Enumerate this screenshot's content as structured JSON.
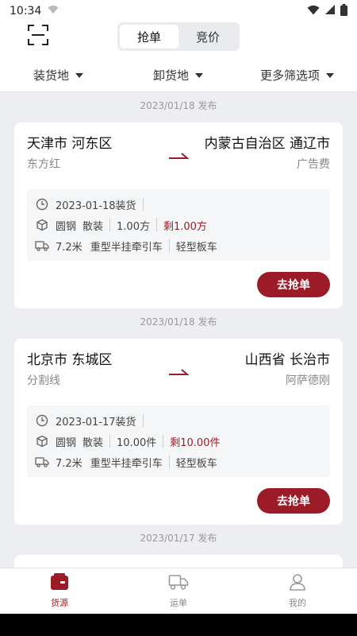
{
  "status": {
    "time": "10:34"
  },
  "header": {
    "tabs": [
      {
        "label": "抢单",
        "active": true
      },
      {
        "label": "竞价",
        "active": false
      }
    ]
  },
  "filters": [
    {
      "label": "装货地"
    },
    {
      "label": "卸货地"
    },
    {
      "label": "更多筛选项"
    }
  ],
  "listings": [
    {
      "publish": "2023/01/18 发布",
      "from_city": "天津市 河东区",
      "from_sub": "东方红",
      "to_city": "内蒙古自治区 通辽市",
      "to_sub": "广告费",
      "load_date": "2023-01-18装货",
      "cargo": "圆钢",
      "packing": "散装",
      "amount": "1.00方",
      "remaining": "剩1.00方",
      "length": "7.2米",
      "truck_type": "重型半挂牵引车",
      "body_type": "轻型板车",
      "button": "去抢单"
    },
    {
      "publish": "2023/01/18 发布",
      "from_city": "北京市 东城区",
      "from_sub": "分割线",
      "to_city": "山西省 长治市",
      "to_sub": "阿萨德刚",
      "load_date": "2023-01-17装货",
      "cargo": "圆钢",
      "packing": "散装",
      "amount": "10.00件",
      "remaining": "剩10.00件",
      "length": "7.2米",
      "truck_type": "重型半挂牵引车",
      "body_type": "轻型板车",
      "button": "去抢单"
    }
  ],
  "next_publish": "2023/01/17 发布",
  "tabbar": [
    {
      "label": "货源",
      "active": true,
      "icon": "cargo-icon"
    },
    {
      "label": "运单",
      "active": false,
      "icon": "truck-icon"
    },
    {
      "label": "我的",
      "active": false,
      "icon": "user-icon"
    }
  ],
  "colors": {
    "accent": "#9b1b27",
    "background": "#eceef1"
  }
}
